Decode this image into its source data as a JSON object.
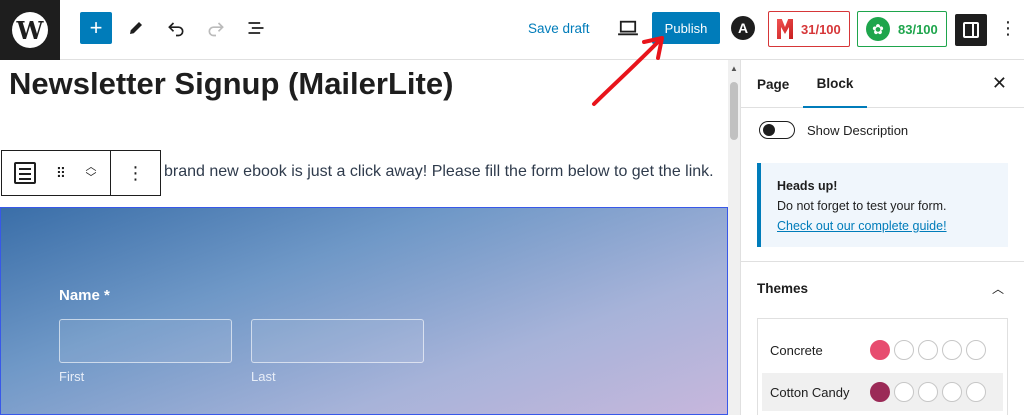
{
  "topbar": {
    "logo_letter": "W",
    "add_icon": "plus-icon",
    "tools_icon": "pencil-icon",
    "undo_icon": "undo-icon",
    "redo_icon": "redo-icon",
    "list_view_icon": "list-view-icon",
    "save_draft_label": "Save draft",
    "preview_icon": "laptop-icon",
    "publish_label": "Publish",
    "astra_letter": "A",
    "readability_score": "31/100",
    "seo_score": "83/100",
    "settings_icon": "sidebar-icon",
    "more_icon": "ellipsis-vertical-icon"
  },
  "editor": {
    "post_title": "Newsletter Signup (MailerLite)",
    "intro_text": "brand new ebook is just a click away! Please fill the form below to get the link.",
    "block_toolbar": {
      "block_icon": "form-icon",
      "drag_icon": "drag-handle-icon",
      "move_up_icon": "chevron-up-icon",
      "move_down_icon": "chevron-down-icon",
      "options_icon": "ellipsis-vertical-icon"
    },
    "form": {
      "name_label": "Name *",
      "first_sub": "First",
      "last_sub": "Last",
      "first_value": "",
      "last_value": ""
    }
  },
  "sidebar": {
    "tab_page": "Page",
    "tab_block": "Block",
    "close_icon": "close-icon",
    "toggle_label": "Show Description",
    "notice": {
      "title": "Heads up!",
      "text": "Do not forget to test your form.",
      "link": "Check out our complete guide!"
    },
    "themes_title": "Themes",
    "themes_chevron": "chevron-up-icon",
    "themes": [
      {
        "name": "Concrete",
        "accent": "#e74c6f"
      },
      {
        "name": "Cotton Candy",
        "accent": "#9b2a57"
      }
    ]
  },
  "colors": {
    "primary": "#007cba",
    "readability_red": "#d63638",
    "seo_green": "#1ea54c",
    "annotation_red": "#e8141b"
  }
}
